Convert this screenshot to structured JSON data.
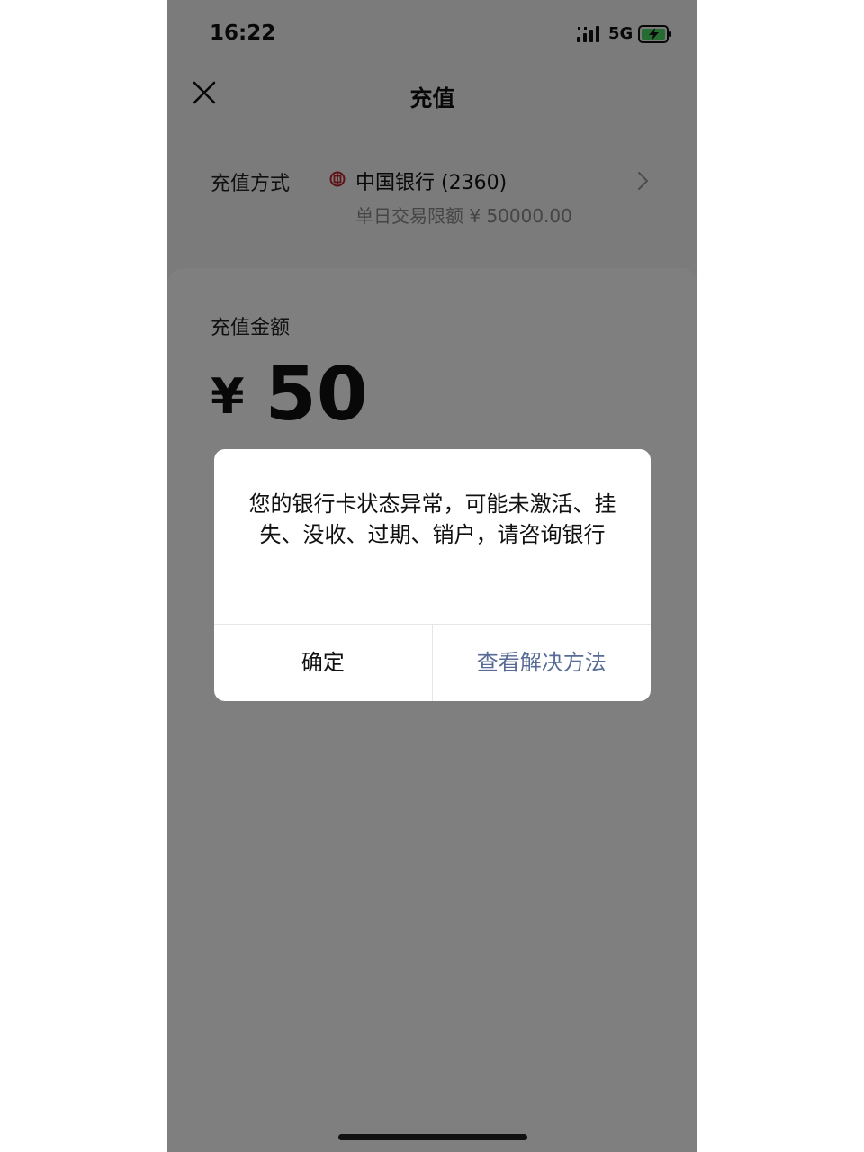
{
  "status_bar": {
    "time": "16:22",
    "network": "5G",
    "battery_color": "#4cd964"
  },
  "nav": {
    "title": "充值"
  },
  "payment_method": {
    "label": "充值方式",
    "bank_name": "中国银行 (2360)",
    "limit": "单日交易限额 ¥ 50000.00",
    "bank_icon_color": "#c0272d"
  },
  "amount": {
    "label": "充值金额",
    "currency": "¥",
    "value": "50"
  },
  "dialog": {
    "message": "您的银行卡状态异常，可能未激活、挂失、没收、过期、销户，请咨询银行",
    "confirm_label": "确定",
    "solution_label": "查看解决方法",
    "link_color": "#576b95"
  },
  "icons": {
    "close": "close-icon",
    "chevron": "chevron-right-icon",
    "bank": "bank-of-china-icon",
    "signal": "cellular-signal-icon",
    "battery": "battery-charging-icon"
  }
}
